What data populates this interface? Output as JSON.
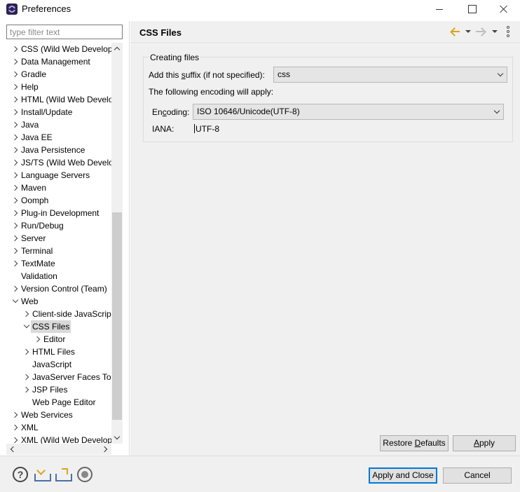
{
  "window": {
    "title": "Preferences"
  },
  "filter": {
    "placeholder": "type filter text",
    "value": ""
  },
  "tree": {
    "items": [
      {
        "label": "CSS (Wild Web Developer)",
        "depth": 0,
        "twisty": "closed"
      },
      {
        "label": "Data Management",
        "depth": 0,
        "twisty": "closed"
      },
      {
        "label": "Gradle",
        "depth": 0,
        "twisty": "closed"
      },
      {
        "label": "Help",
        "depth": 0,
        "twisty": "closed"
      },
      {
        "label": "HTML (Wild Web Developer)",
        "depth": 0,
        "twisty": "closed"
      },
      {
        "label": "Install/Update",
        "depth": 0,
        "twisty": "closed"
      },
      {
        "label": "Java",
        "depth": 0,
        "twisty": "closed"
      },
      {
        "label": "Java EE",
        "depth": 0,
        "twisty": "closed"
      },
      {
        "label": "Java Persistence",
        "depth": 0,
        "twisty": "closed"
      },
      {
        "label": "JS/TS (Wild Web Developer)",
        "depth": 0,
        "twisty": "closed"
      },
      {
        "label": "Language Servers",
        "depth": 0,
        "twisty": "closed"
      },
      {
        "label": "Maven",
        "depth": 0,
        "twisty": "closed"
      },
      {
        "label": "Oomph",
        "depth": 0,
        "twisty": "closed"
      },
      {
        "label": "Plug-in Development",
        "depth": 0,
        "twisty": "closed"
      },
      {
        "label": "Run/Debug",
        "depth": 0,
        "twisty": "closed"
      },
      {
        "label": "Server",
        "depth": 0,
        "twisty": "closed"
      },
      {
        "label": "Terminal",
        "depth": 0,
        "twisty": "closed"
      },
      {
        "label": "TextMate",
        "depth": 0,
        "twisty": "closed"
      },
      {
        "label": "Validation",
        "depth": 0,
        "twisty": "none"
      },
      {
        "label": "Version Control (Team)",
        "depth": 0,
        "twisty": "closed"
      },
      {
        "label": "Web",
        "depth": 0,
        "twisty": "open"
      },
      {
        "label": "Client-side JavaScript",
        "depth": 1,
        "twisty": "closed"
      },
      {
        "label": "CSS Files",
        "depth": 1,
        "twisty": "open",
        "selected": true
      },
      {
        "label": "Editor",
        "depth": 2,
        "twisty": "closed"
      },
      {
        "label": "HTML Files",
        "depth": 1,
        "twisty": "closed"
      },
      {
        "label": "JavaScript",
        "depth": 1,
        "twisty": "none"
      },
      {
        "label": "JavaServer Faces Tools",
        "depth": 1,
        "twisty": "closed"
      },
      {
        "label": "JSP Files",
        "depth": 1,
        "twisty": "closed"
      },
      {
        "label": "Web Page Editor",
        "depth": 1,
        "twisty": "none"
      },
      {
        "label": "Web Services",
        "depth": 0,
        "twisty": "closed"
      },
      {
        "label": "XML",
        "depth": 0,
        "twisty": "closed"
      },
      {
        "label": "XML (Wild Web Developer)",
        "depth": 0,
        "twisty": "closed"
      }
    ]
  },
  "page": {
    "title": "CSS Files",
    "group_label": "Creating files",
    "suffix_label_pre": "Add this ",
    "suffix_label_mnemonic": "s",
    "suffix_label_post": "uffix (if not specified):",
    "suffix_value": "css",
    "encoding_note": "The following encoding will apply:",
    "encoding_label_pre": "En",
    "encoding_label_mnemonic": "c",
    "encoding_label_post": "oding:",
    "encoding_value": "ISO 10646/Unicode(UTF-8)",
    "iana_label": "IANA:",
    "iana_value": "UTF-8",
    "restore_pre": "Restore ",
    "restore_mnemonic": "D",
    "restore_post": "efaults",
    "apply_mnemonic": "A",
    "apply_post": "pply"
  },
  "footer": {
    "apply_close": "Apply and Close",
    "cancel": "Cancel",
    "help_glyph": "?"
  }
}
